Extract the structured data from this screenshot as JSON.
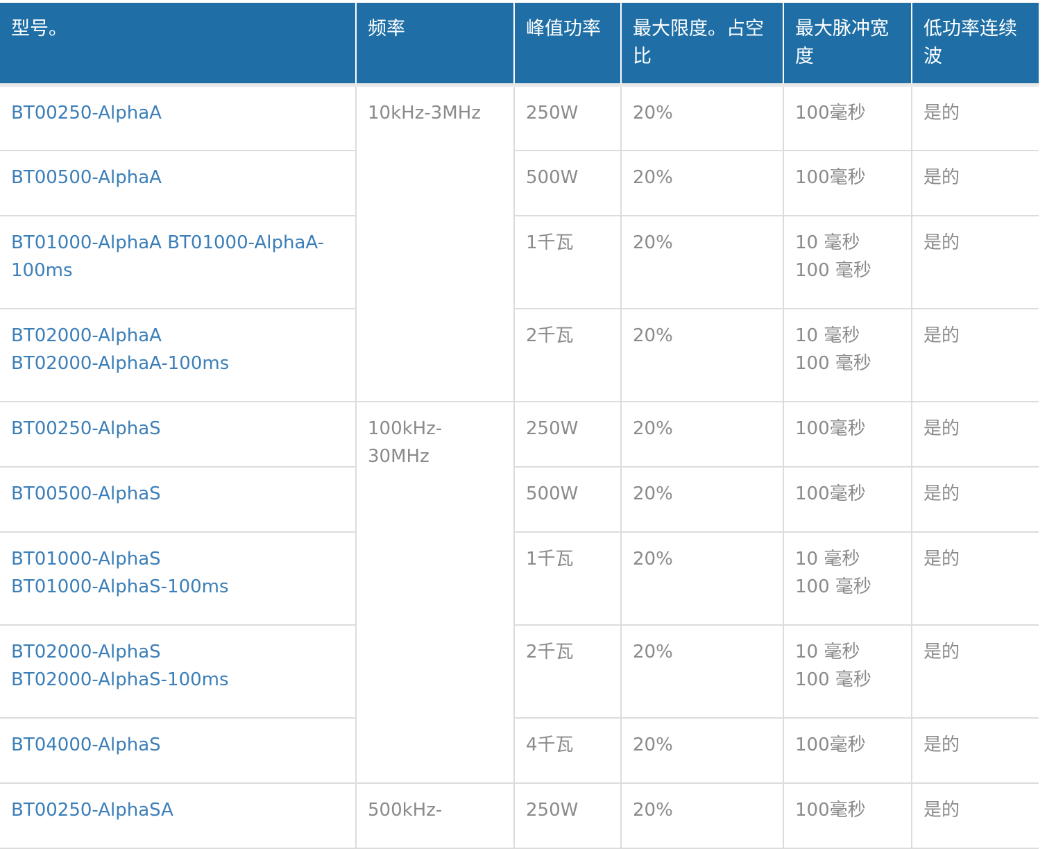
{
  "headers": {
    "model": "型号。",
    "frequency": "频率",
    "peak_power": "峰值功率",
    "max_duty": "最大限度。占空比",
    "max_pulse": "最大脉冲宽度",
    "low_power_cw": "低功率连续波"
  },
  "groups": {
    "a": {
      "frequency": "10kHz-3MHz"
    },
    "s": {
      "frequency": "100kHz-30MHz"
    },
    "sa": {
      "frequency": "500kHz-"
    }
  },
  "rows": [
    {
      "model": "BT00250-AlphaA",
      "power": "250W",
      "duty": "20%",
      "pulse": "100毫秒",
      "cw": "是的"
    },
    {
      "model": "BT00500-AlphaA",
      "power": "500W",
      "duty": "20%",
      "pulse": "100毫秒",
      "cw": "是的"
    },
    {
      "model": "BT01000-AlphaA BT01000-AlphaA-100ms",
      "power": "1千瓦",
      "duty": "20%",
      "pulse_1": "10 毫秒",
      "pulse_2": "100 毫秒",
      "cw": "是的"
    },
    {
      "model_1": "BT02000-AlphaA",
      "model_2": "BT02000-AlphaA-100ms",
      "power": "2千瓦",
      "duty": "20%",
      "pulse_1": "10 毫秒",
      "pulse_2": "100 毫秒",
      "cw": "是的"
    },
    {
      "model": "BT00250-AlphaS",
      "power": "250W",
      "duty": "20%",
      "pulse": "100毫秒",
      "cw": "是的"
    },
    {
      "model": "BT00500-AlphaS",
      "power": "500W",
      "duty": "20%",
      "pulse": "100毫秒",
      "cw": "是的"
    },
    {
      "model_1": "BT01000-AlphaS",
      "model_2": "BT01000-AlphaS-100ms",
      "power": "1千瓦",
      "duty": "20%",
      "pulse_1": "10 毫秒",
      "pulse_2": "100 毫秒",
      "cw": "是的"
    },
    {
      "model_1": "BT02000-AlphaS",
      "model_2": "BT02000-AlphaS-100ms",
      "power": "2千瓦",
      "duty": "20%",
      "pulse_1": "10 毫秒",
      "pulse_2": "100 毫秒",
      "cw": "是的"
    },
    {
      "model": "BT04000-AlphaS",
      "power": "4千瓦",
      "duty": "20%",
      "pulse": "100毫秒",
      "cw": "是的"
    },
    {
      "model": "BT00250-AlphaSA",
      "power": "250W",
      "duty": "20%",
      "pulse": "100毫秒",
      "cw": "是的"
    }
  ],
  "colors": {
    "header_bg": "#1f6fa6",
    "link": "#3c7fb8",
    "text": "#8a8a8a"
  }
}
